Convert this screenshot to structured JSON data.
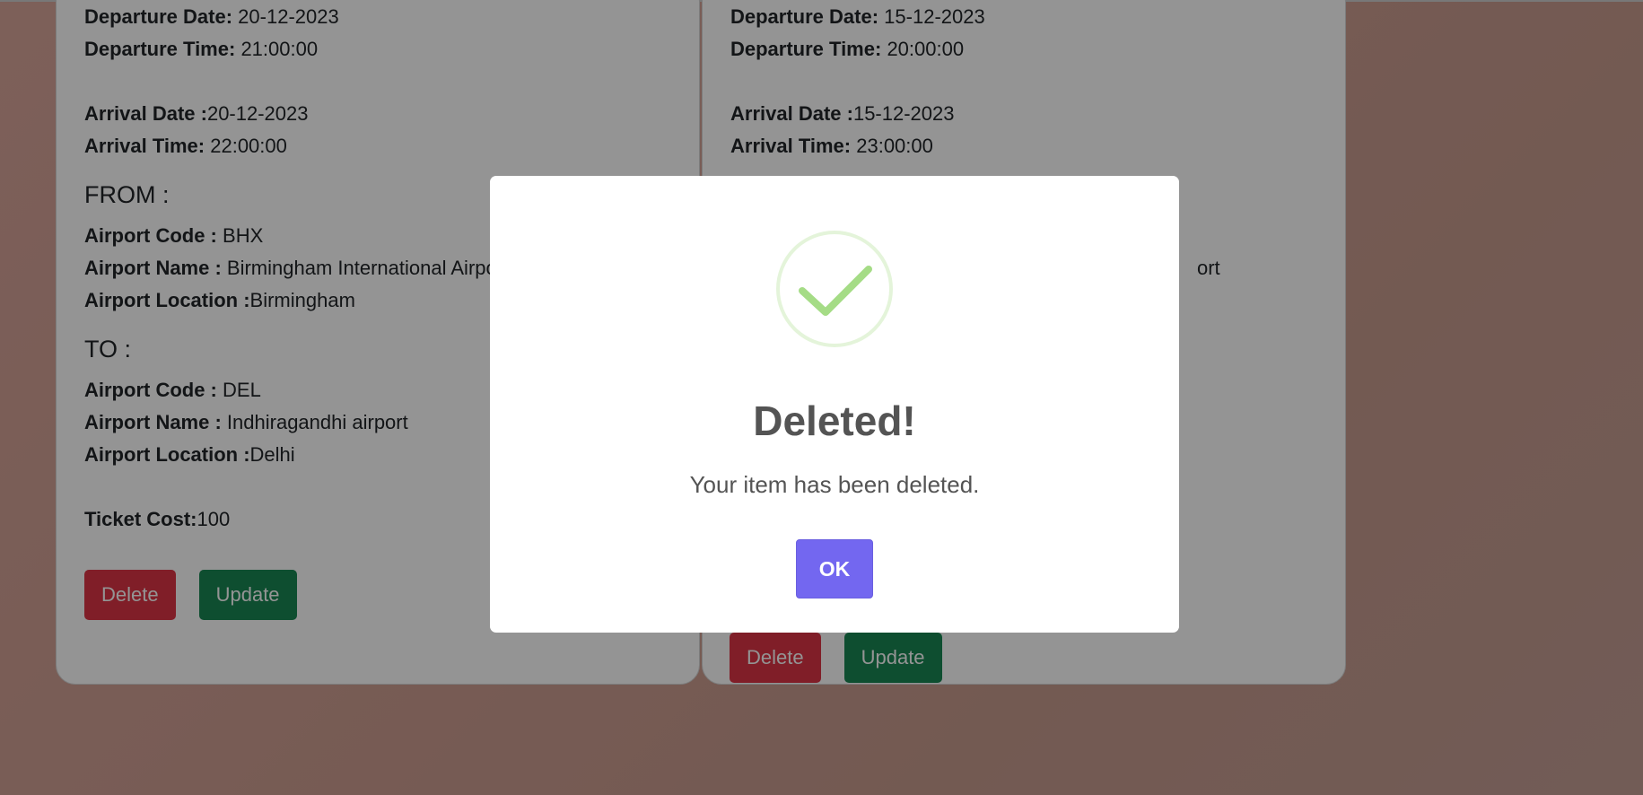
{
  "labels": {
    "departure_date": "Departure Date:",
    "departure_time": "Departure Time:",
    "arrival_date": "Arrival Date :",
    "arrival_time": "Arrival Time:",
    "from_heading": "FROM :",
    "to_heading": "TO :",
    "airport_code": "Airport Code :",
    "airport_name": "Airport Name :",
    "airport_location": "Airport Location :",
    "ticket_cost": "Ticket Cost:"
  },
  "flights": [
    {
      "departure_date": "20-12-2023",
      "departure_time": "21:00:00",
      "arrival_date": "20-12-2023",
      "arrival_time": "22:00:00",
      "from": {
        "code": "BHX",
        "name": "Birmingham International Airport",
        "location": "Birmingham"
      },
      "to": {
        "code": "DEL",
        "name": "Indhiragandhi airport",
        "location": "Delhi"
      },
      "ticket_cost": "100",
      "delete_label": "Delete",
      "update_label": "Update"
    },
    {
      "departure_date": "15-12-2023",
      "departure_time": "20:00:00",
      "arrival_date": "15-12-2023",
      "arrival_time": "23:00:00",
      "from": {
        "code": "",
        "name": "ort",
        "location": ""
      },
      "to": {
        "code": "",
        "name": "",
        "location": ""
      },
      "ticket_cost": "",
      "delete_label": "Delete",
      "update_label": "Update"
    }
  ],
  "modal": {
    "icon": "checkmark-success-icon",
    "title": "Deleted!",
    "text": "Your item has been deleted.",
    "ok_label": "OK"
  },
  "colors": {
    "delete": "#dc3545",
    "update": "#198754",
    "confirm": "#7367f0",
    "success": "#a5dc86"
  }
}
